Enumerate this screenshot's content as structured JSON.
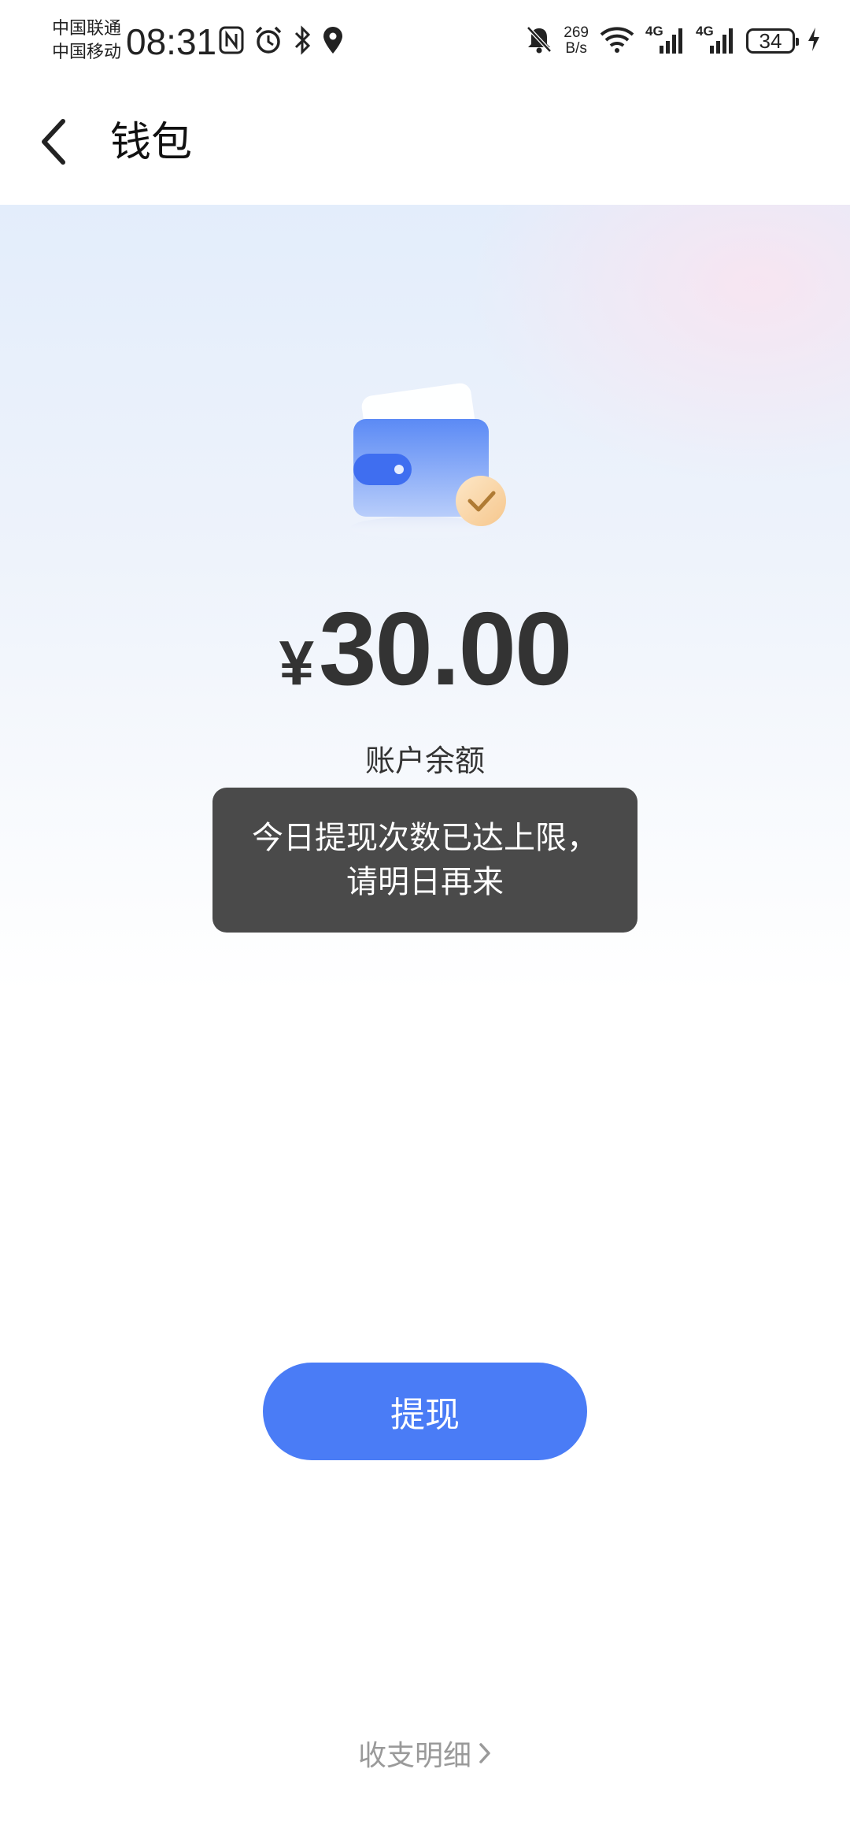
{
  "status_bar": {
    "carrier1": "中国联通",
    "carrier2": "中国移动",
    "time": "08:31",
    "net_speed_value": "269",
    "net_speed_unit": "B/s",
    "signal1_label": "4G",
    "signal2_label": "4G",
    "battery_level": "34",
    "icons_left": [
      "nfc-icon",
      "alarm-icon",
      "bluetooth-icon",
      "location-icon"
    ],
    "icons_right": [
      "mute-bell-icon",
      "wifi-icon",
      "signal-icon",
      "signal-icon",
      "battery-icon",
      "charging-icon"
    ]
  },
  "header": {
    "title": "钱包"
  },
  "wallet": {
    "currency": "¥",
    "amount": "30.00",
    "balance_label": "账户余额"
  },
  "toast": {
    "line1": "今日提现次数已达上限，",
    "line2": "请明日再来"
  },
  "actions": {
    "withdraw_label": "提现",
    "details_label": "收支明细"
  },
  "colors": {
    "accent": "#4a7cf6",
    "toast_bg": "#4a4a4a"
  }
}
